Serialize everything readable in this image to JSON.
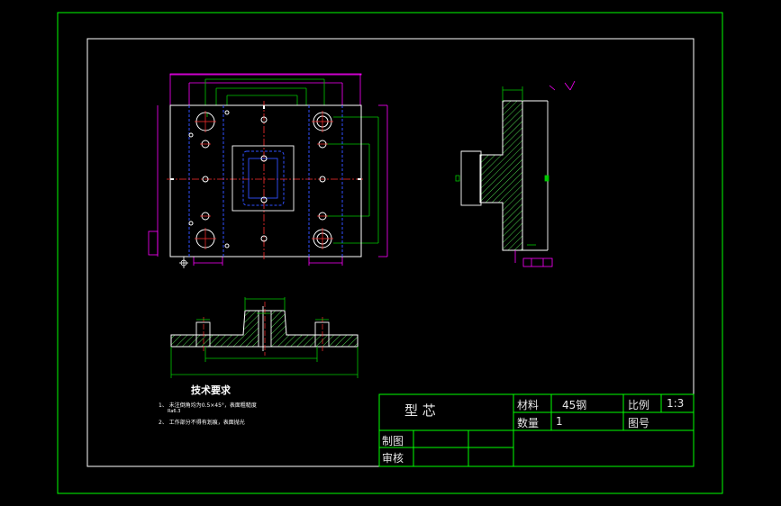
{
  "window": {
    "background": "#d4d0c8",
    "viewport_color": "#000000"
  },
  "colors": {
    "frame": "#00ff00",
    "section": "#4cd24c",
    "dimension": "#ff00ff",
    "outline": "#ffffff",
    "centerline": "#ff3030",
    "hidden": "#3050ff",
    "dimgreen": "#00c800"
  },
  "title_block": {
    "part_name": "型 芯",
    "material_label": "材料",
    "material_value": "45钢",
    "scale_label": "比例",
    "scale_value": "1:3",
    "quantity_label": "数量",
    "quantity_value": "1",
    "drawing_no_label": "图号",
    "drawn_by_label": "制图",
    "checked_by_label": "审核"
  },
  "technical_requirements": {
    "heading": "技术要求",
    "items": [
      "1、 未注倒角均为0.5×45°，表面粗糙度",
      "Ra6.3",
      "2、 工作部分不得有划痕，表面抛光"
    ]
  }
}
